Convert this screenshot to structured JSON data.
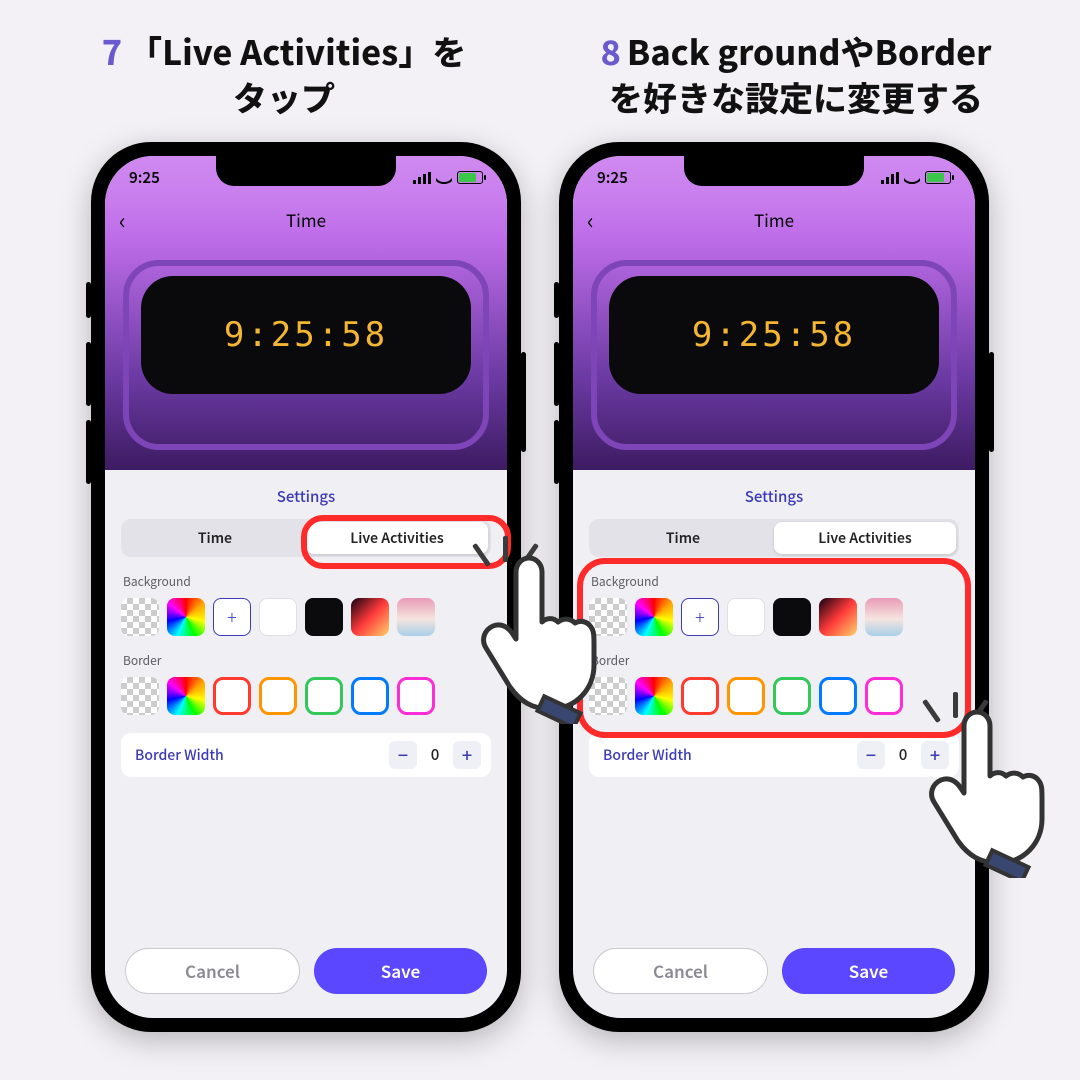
{
  "captions": {
    "step7": {
      "num": "7",
      "text_l1": "「Live Activities」を",
      "text_l2": "タップ"
    },
    "step8": {
      "num": "8",
      "text_l1": "Back groundやBorder",
      "text_l2": "を好きな設定に変更する"
    }
  },
  "status": {
    "time": "9:25"
  },
  "nav": {
    "title": "Time"
  },
  "preview": {
    "clock": "9:25:58"
  },
  "settings": {
    "title": "Settings",
    "tabs": {
      "time": "Time",
      "live": "Live Activities"
    },
    "background_label": "Background",
    "border_label": "Border",
    "add_symbol": "+",
    "border_width_label": "Border Width",
    "border_width_value": "0",
    "minus": "−",
    "plus": "+"
  },
  "footer": {
    "cancel": "Cancel",
    "save": "Save"
  }
}
